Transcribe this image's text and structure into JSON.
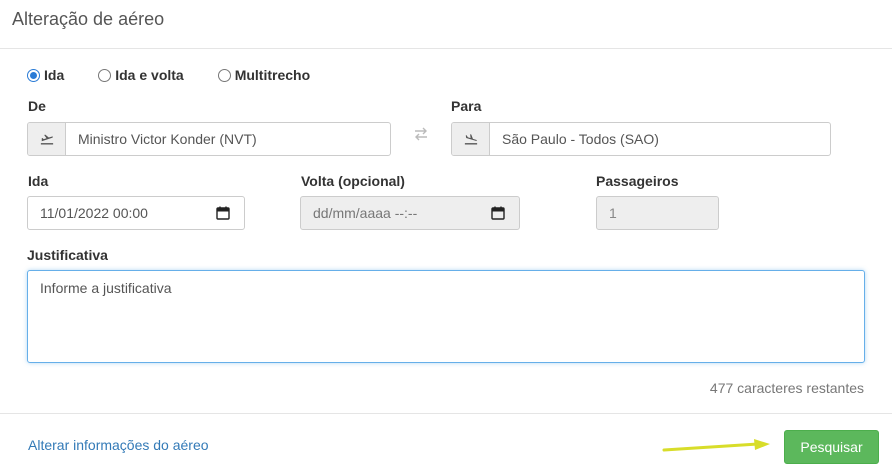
{
  "modal": {
    "title": "Alteração de aéreo"
  },
  "trip_type": {
    "options": [
      {
        "label": "Ida",
        "checked": true
      },
      {
        "label": "Ida e volta",
        "checked": false
      },
      {
        "label": "Multitrecho",
        "checked": false
      }
    ]
  },
  "origin": {
    "label": "De",
    "value": "Ministro Victor Konder (NVT)",
    "icon": "takeoff-icon"
  },
  "destination": {
    "label": "Para",
    "value": "São Paulo - Todos (SAO)",
    "icon": "landing-icon"
  },
  "swap": {
    "icon": "swap-arrows-icon"
  },
  "departure": {
    "label": "Ida",
    "value": "11/01/2022 00:00"
  },
  "return": {
    "label": "Volta (opcional)",
    "placeholder": "dd/mm/aaaa --:--"
  },
  "passengers": {
    "label": "Passageiros",
    "value": "1"
  },
  "justification": {
    "label": "Justificativa",
    "placeholder": "Informe a justificativa",
    "counter": "477 caracteres restantes"
  },
  "footer": {
    "link": "Alterar informações do aéreo",
    "search_button": "Pesquisar"
  },
  "colors": {
    "accent": "#2a7bd6",
    "link": "#337ab7",
    "button": "#5cb85c",
    "arrow": "#d8dd2a"
  }
}
